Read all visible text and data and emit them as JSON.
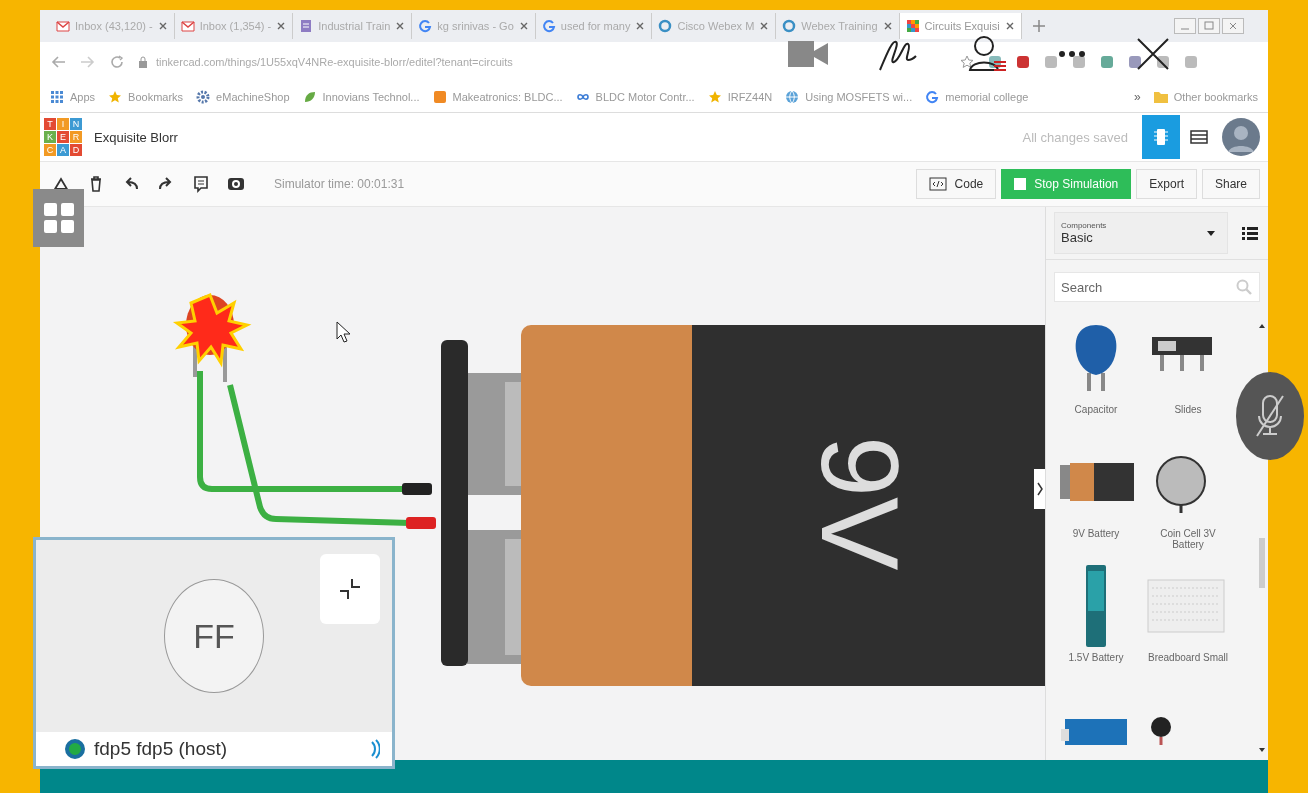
{
  "browser": {
    "tabs": [
      {
        "title": "Inbox (43,120) -",
        "kind": "gmail",
        "selected": false
      },
      {
        "title": "Inbox (1,354) -",
        "kind": "gmail",
        "selected": false
      },
      {
        "title": "Industrial Train",
        "kind": "doc",
        "selected": false
      },
      {
        "title": "kg srinivas - Go",
        "kind": "google",
        "selected": false
      },
      {
        "title": "used for many",
        "kind": "google",
        "selected": false
      },
      {
        "title": "Cisco Webex M",
        "kind": "webex",
        "selected": false
      },
      {
        "title": "Webex Training",
        "kind": "webex",
        "selected": false
      },
      {
        "title": "Circuits Exquisi",
        "kind": "tinkercad",
        "selected": true
      }
    ],
    "url": "tinkercad.com/things/1U55xqV4NRe-exquisite-blorr/editel?tenant=circuits",
    "bookmarks": [
      {
        "label": "Apps",
        "kind": "apps"
      },
      {
        "label": "Bookmarks",
        "kind": "star"
      },
      {
        "label": "eMachineShop",
        "kind": "gear"
      },
      {
        "label": "Innovians Technol...",
        "kind": "leaf"
      },
      {
        "label": "Makeatronics: BLDC...",
        "kind": "box"
      },
      {
        "label": "BLDC Motor Contr...",
        "kind": "infinity"
      },
      {
        "label": "IRFZ44N",
        "kind": "star"
      },
      {
        "label": "Using MOSFETS wi...",
        "kind": "globe"
      },
      {
        "label": "memorial college",
        "kind": "google"
      }
    ],
    "more": "»",
    "other_bookmarks": "Other bookmarks"
  },
  "app": {
    "logo": [
      "T",
      "I",
      "N",
      "K",
      "E",
      "R",
      "C",
      "A",
      "D"
    ],
    "title": "Exquisite Blorr",
    "save_status": "All changes saved",
    "simulator_time": "Simulator time: 00:01:31",
    "buttons": [
      {
        "label": "Code",
        "kind": "code"
      },
      {
        "label": "Stop Simulation",
        "kind": "primary"
      },
      {
        "label": "Export",
        "kind": "plain"
      },
      {
        "label": "Share",
        "kind": "plain"
      }
    ]
  },
  "canvas": {
    "battery_label": "9V"
  },
  "components": {
    "caption": "Components",
    "category": "Basic",
    "search": {
      "placeholder": "Search"
    },
    "items": [
      {
        "kind": "capacitor",
        "name": "Capacitor"
      },
      {
        "kind": "switch",
        "name": "Slides"
      },
      {
        "kind": "battery9v",
        "name": "9V Battery"
      },
      {
        "kind": "coincell",
        "name": "Coin Cell 3V Battery"
      },
      {
        "kind": "aa",
        "name": "1.5V Battery"
      },
      {
        "kind": "breadboard",
        "name": "Breadboard Small"
      },
      {
        "kind": "board"
      },
      {
        "kind": "motor"
      }
    ]
  },
  "meeting": {
    "initials": "FF",
    "participant": "fdp5 fdp5 (host)"
  }
}
